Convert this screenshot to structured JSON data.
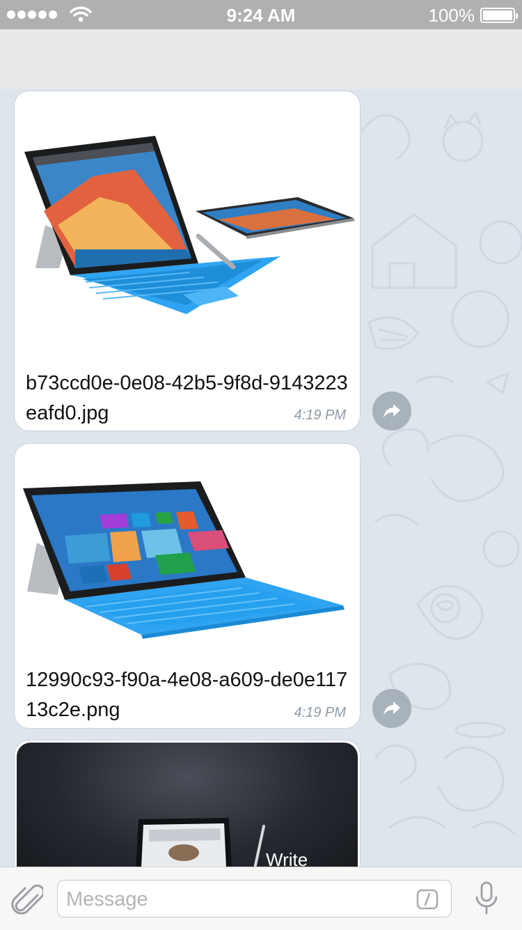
{
  "status_bar": {
    "time": "9:24 AM",
    "battery": "100%",
    "battery_level": 1.0
  },
  "messages": [
    {
      "type": "document",
      "filename": "b73ccd0e-0e08-42b5-9f8d-9143223eafd0.jpg",
      "time": "4:19 PM",
      "preview": "surface-pro-4-laptop-photo"
    },
    {
      "type": "document",
      "filename": "12990c93-f90a-4e08-a609-de0e11713c2e.png",
      "time": "4:19 PM",
      "preview": "surface-3-tablet-photo"
    },
    {
      "type": "video",
      "caption": "Write",
      "preview": "tablet-video-dark"
    }
  ],
  "input": {
    "placeholder": "Message"
  },
  "icons": {
    "attach": "paperclip-icon",
    "command": "slash-command-icon",
    "mic": "microphone-icon",
    "share": "share-arrow-icon"
  },
  "colors": {
    "status_bar": "#b0b0b0",
    "chat_background": "#dfe5ec",
    "surface_keyboard": "#2ea4f2"
  }
}
